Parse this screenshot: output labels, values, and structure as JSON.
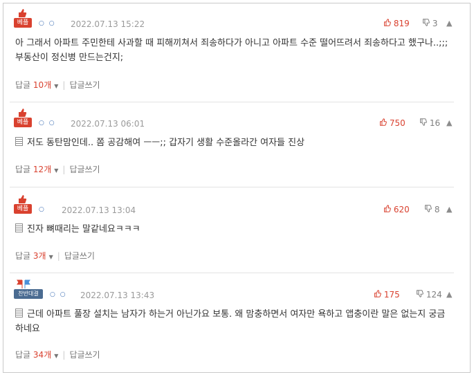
{
  "comments": [
    {
      "badge": "베플",
      "dots": "○ ○",
      "date": "2022.07.13 15:22",
      "up": "819",
      "down": "3",
      "text": "아 그래서 아파트 주민한테 사과할 때 피해끼쳐서 죄송하다가 아니고 아파트 수준 떨어뜨려서 죄송하다고 했구나..;;; 부동산이 정신병 만드는건지;",
      "reply_label": "답글",
      "reply_count": "10개",
      "write_reply": "답글쓰기"
    },
    {
      "badge": "베플",
      "dots": "○ ○",
      "date": "2022.07.13 06:01",
      "up": "750",
      "down": "16",
      "text": "저도 동탄맘인데.. 쫌 공감해여 ㅡㅡ;; 갑자기 생활 수준올라간 여자들 진상",
      "reply_label": "답글",
      "reply_count": "12개",
      "write_reply": "답글쓰기"
    },
    {
      "badge": "베플",
      "dots": "○",
      "date": "2022.07.13 13:04",
      "up": "620",
      "down": "8",
      "text": "진자 뼈때리는 말같네요ㅋㅋㅋ",
      "reply_label": "답글",
      "reply_count": "3개",
      "write_reply": "답글쓰기"
    },
    {
      "badge": "찬반대결",
      "dots": "○ ○",
      "date": "2022.07.13 13:43",
      "up": "175",
      "down": "124",
      "text": "근데 아파트 풀장 설치는 남자가 하는거 아닌가요 보통. 왜 맘충하면서 여자만 욕하고 앱충이란 말은 없는지 궁금하네요",
      "reply_label": "답글",
      "reply_count": "34개",
      "write_reply": "답글쓰기"
    }
  ],
  "colors": {
    "accent": "#d9412f",
    "badge_blue": "#4a6b91",
    "muted": "#9a9a9a"
  }
}
